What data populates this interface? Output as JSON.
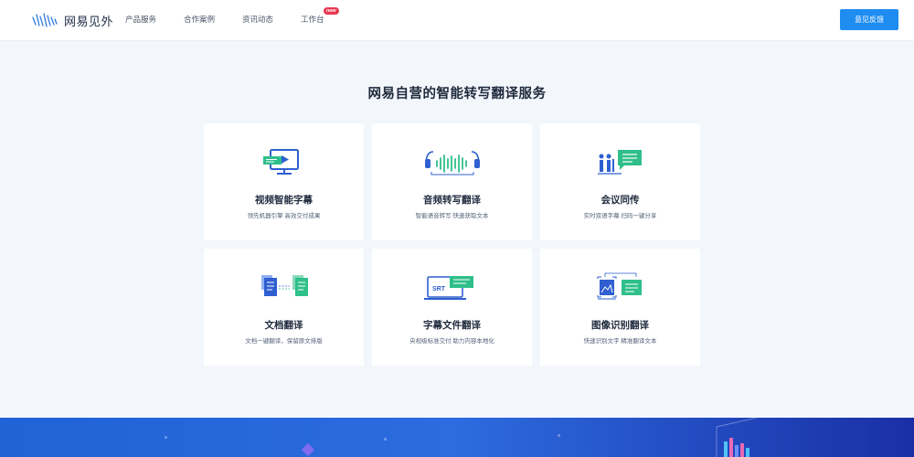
{
  "header": {
    "logo_text": "网易见外",
    "nav": [
      {
        "label": "产品服务"
      },
      {
        "label": "合作案例"
      },
      {
        "label": "资讯动态"
      },
      {
        "label": "工作台",
        "badge": "new"
      }
    ],
    "feedback_button": "意见反馈"
  },
  "main": {
    "title": "网易自营的智能转写翻译服务",
    "cards": [
      {
        "title": "视频智能字幕",
        "desc": "领先机器引擎 高效交付成果",
        "icon": "video-monitor-icon"
      },
      {
        "title": "音频转写翻译",
        "desc": "智能语音转写 快速获取文本",
        "icon": "audio-headphones-icon"
      },
      {
        "title": "会议同传",
        "desc": "实时双语字幕 扫码一键分享",
        "icon": "meeting-interpret-icon"
      },
      {
        "title": "文档翻译",
        "desc": "文档一键翻译，保留原文排版",
        "icon": "document-translate-icon"
      },
      {
        "title": "字幕文件翻译",
        "desc": "央视级标准交付 助力内容本地化",
        "icon": "srt-subtitle-icon"
      },
      {
        "title": "图像识别翻译",
        "desc": "快速识别文字 精准翻译文本",
        "icon": "image-recognition-icon"
      }
    ]
  },
  "colors": {
    "accent": "#1e8cf0",
    "icon_blue": "#2f5fd0",
    "icon_green": "#2fbf8a",
    "badge_red": "#e8384f"
  }
}
